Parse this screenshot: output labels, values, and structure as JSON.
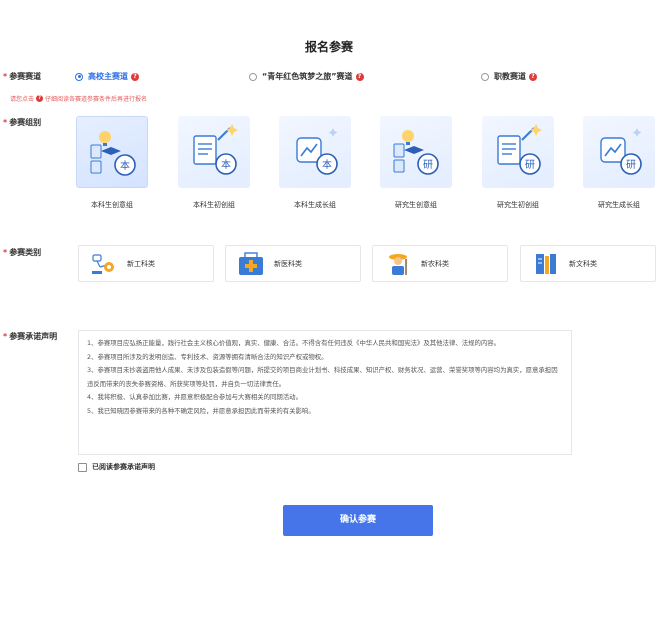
{
  "page": {
    "title": "报名参赛"
  },
  "track": {
    "label": "参赛赛道",
    "options": [
      {
        "label": "高校主赛道",
        "selected": true
      },
      {
        "label": "“青年红色筑梦之旅”赛道",
        "selected": false
      },
      {
        "label": "职教赛道",
        "selected": false
      }
    ],
    "hint_prefix": "请您点击",
    "hint_suffix": "仔细阅读各赛道参赛条件后再进行报名",
    "help_glyph": "?"
  },
  "groups": {
    "label": "参赛组别",
    "items": [
      {
        "name": "本科生创意组",
        "badge": "本",
        "icon": "lightbulb-cap-icon",
        "selected": true
      },
      {
        "name": "本科生初创组",
        "badge": "本",
        "icon": "document-wand-icon",
        "selected": false
      },
      {
        "name": "本科生成长组",
        "badge": "本",
        "icon": "growth-chart-icon",
        "selected": false
      },
      {
        "name": "研究生创意组",
        "badge": "研",
        "icon": "lightbulb-cap-icon",
        "selected": false
      },
      {
        "name": "研究生初创组",
        "badge": "研",
        "icon": "document-wand-icon",
        "selected": false
      },
      {
        "name": "研究生成长组",
        "badge": "研",
        "icon": "growth-chart-icon",
        "selected": false
      }
    ]
  },
  "category": {
    "label": "参赛类别",
    "items": [
      {
        "name": "新工科类",
        "icon": "engineering-robot-icon"
      },
      {
        "name": "新医科类",
        "icon": "medical-kit-icon"
      },
      {
        "name": "新农科类",
        "icon": "farmer-icon"
      },
      {
        "name": "新文科类",
        "icon": "books-icon"
      }
    ]
  },
  "statement": {
    "label": "参赛承诺声明",
    "paragraphs": [
      "1、参赛项目应弘扬正能量，践行社会主义核心价值观，真实、健康、合法。不得含有任何违反《中华人民共和国宪法》及其他法律、法规的内容。",
      "2、参赛项目所涉及的发明创造、专利技术、资源等拥有清晰合法的知识产权或物权。",
      "3、参赛项目未抄袭盗用他人成果、未涉及包装造假等问题，所提交的项目商业计划书、科技成果、知识产权、财务状况、运营、荣誉奖项等内容均为真实，愿意承担因违反而带来的丧失参赛资格、所获奖项等处罚，并自负一切法律责任。",
      "4、我将积极、认真参加比赛，并愿意积极配合参加与大赛相关的同期活动。",
      "5、我已知晓因参赛带来的各种不确定风险，并愿意承担因此而带来的有关影响。"
    ],
    "agree_label": "已阅读参赛承诺声明"
  },
  "actions": {
    "confirm_label": "确认参赛"
  },
  "colors": {
    "accent": "#4575e8",
    "required": "#e03a3a",
    "hint": "#e55b5b"
  }
}
